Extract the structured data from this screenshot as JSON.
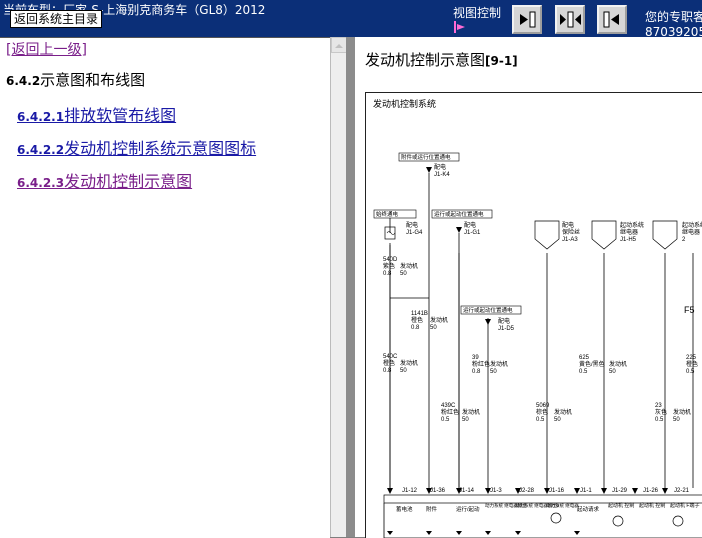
{
  "topbar": {
    "car_text": "当前车型：厂家-S-上海别克商务车（GL8）2012",
    "home_button": "返回系统主目录",
    "view_control_label": "视图控制",
    "expert_label": "您的专职客",
    "phone": "87039205"
  },
  "icons": [
    "page-forward-icon",
    "split-view-icon",
    "page-back-icon"
  ],
  "left": {
    "back_link": "[返回上一级]",
    "section_number": "6.4.2",
    "section_title": "示意图和布线图",
    "items": [
      {
        "num": "6.4.2.1",
        "label": "排放软管布线图"
      },
      {
        "num": "6.4.2.2",
        "label": "发动机控制系统示意图图标"
      },
      {
        "num": "6.4.2.3",
        "label": "发动机控制示意图"
      }
    ]
  },
  "right": {
    "title": "发动机控制示意图",
    "title_suffix": "[9-1]",
    "diagram": {
      "heading": "发动机控制系统",
      "boxes": [
        "附件或运行位置通电",
        "始终通电",
        "运行或起动位置通电",
        "运行或起动位置通电"
      ],
      "feeds": [
        [
          "配电",
          "J1-K4"
        ],
        [
          "配电",
          "J1-G4"
        ],
        [
          "配电",
          "J1-G1"
        ],
        [
          "配电",
          "J1-D5"
        ],
        [
          "配电",
          "保险丝",
          "J1-A3"
        ],
        [
          "起动系统",
          "继电器",
          "J1-H5"
        ],
        [
          "起动系统",
          "继电器",
          "2"
        ]
      ],
      "wires": [
        [
          "540D",
          "紫色",
          "0.8",
          "发动机",
          "50"
        ],
        [
          "1141B",
          "橙色",
          "0.8",
          "发动机",
          "50"
        ],
        [
          "540C",
          "橙色",
          "0.8",
          "发动机",
          "50"
        ],
        [
          "39",
          "粉红色",
          "0.8",
          "发动机",
          "50"
        ],
        [
          "439C",
          "粉红色",
          "0.5",
          "发动机",
          "50"
        ],
        [
          "5069",
          "棕色",
          "0.5",
          "发动机",
          "50"
        ],
        [
          "625",
          "黄色/黑色",
          "0.5",
          "发动机",
          "50"
        ],
        [
          "23",
          "灰色",
          "0.5",
          "发动机",
          "50"
        ],
        [
          "225",
          "橙色",
          "0.5",
          "",
          ""
        ],
        [
          "F5",
          "",
          "",
          "",
          ""
        ]
      ],
      "connectors": [
        "J1-12",
        "J1-36",
        "J1-14",
        "J1-3",
        "J2-28",
        "J1-16",
        "J1-1",
        "J1-29",
        "J1-26",
        "J2-21"
      ],
      "bottom_labels": [
        "蓄电池",
        "附件",
        "运行/起动",
        "动力系统 继电器输出",
        "动力系统 继电器输出2",
        "动力系统 继电器",
        "起动请求",
        "起动机 控制",
        "起动机 控制",
        "起动机 F端子"
      ]
    }
  }
}
